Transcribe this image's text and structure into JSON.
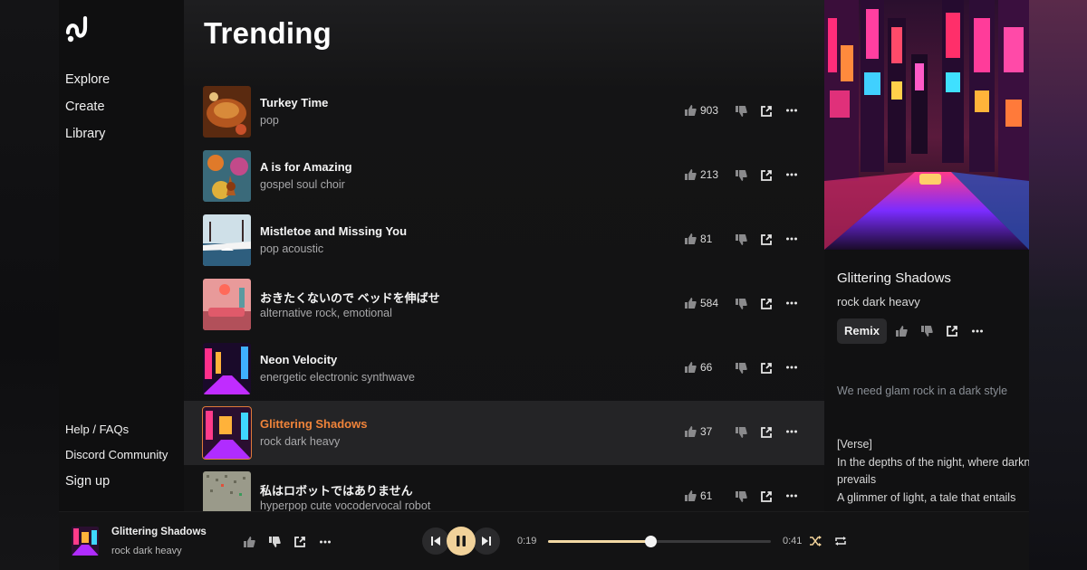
{
  "sidebar": {
    "logo_icon": "wave-logo-icon",
    "nav": [
      {
        "label": "Explore"
      },
      {
        "label": "Create"
      },
      {
        "label": "Library"
      }
    ],
    "footer": [
      {
        "label": "Help / FAQs"
      },
      {
        "label": "Discord Community"
      },
      {
        "label": "Sign up"
      }
    ]
  },
  "main": {
    "title": "Trending",
    "songs": [
      {
        "title": "Turkey Time",
        "genre": "pop",
        "likes": "903",
        "active": false
      },
      {
        "title": "A is for Amazing",
        "genre": "gospel soul choir",
        "likes": "213",
        "active": false
      },
      {
        "title": "Mistletoe and Missing You",
        "genre": "pop acoustic",
        "likes": "81",
        "active": false
      },
      {
        "title": "おきたくないので ベッドを伸ばせ",
        "genre": "alternative rock, emotional",
        "likes": "584",
        "active": false
      },
      {
        "title": "Neon Velocity",
        "genre": "energetic electronic synthwave",
        "likes": "66",
        "active": false
      },
      {
        "title": "Glittering Shadows",
        "genre": "rock dark heavy",
        "likes": "37",
        "active": true
      },
      {
        "title": "私はロボットではありません",
        "genre": "hyperpop cute vocodervocal robot",
        "likes": "61",
        "active": false
      }
    ]
  },
  "panel": {
    "title": "Glittering Shadows",
    "genre": "rock dark heavy",
    "remix_label": "Remix",
    "prompt": "We need glam rock in a dark style",
    "lyrics": [
      "[Verse]",
      "In the depths of the night, where darkne",
      "prevails",
      "A glimmer of light, a tale that entails"
    ]
  },
  "player": {
    "title": "Glittering Shadows",
    "genre": "rock dark heavy",
    "current_time": "0:19",
    "total_time": "0:41",
    "progress": 0.46
  },
  "colors": {
    "accent": "#f0843a",
    "play_button": "#f1d29a",
    "progress": "#f3d9a4"
  }
}
